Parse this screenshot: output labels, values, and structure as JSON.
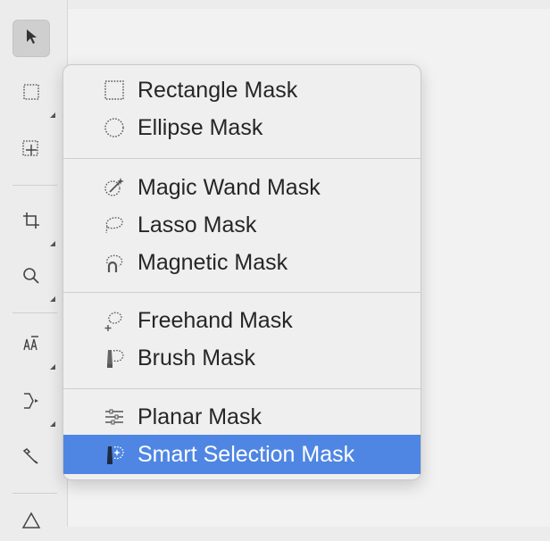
{
  "toolbar": {
    "tools": [
      {
        "icon": "arrow-pointer-icon",
        "selected": true
      },
      {
        "icon": "rectangle-mask-icon"
      },
      {
        "icon": "crosshair-select-icon"
      },
      {
        "icon": "crop-icon"
      },
      {
        "icon": "magnifier-icon"
      },
      {
        "icon": "text-format-icon"
      },
      {
        "icon": "bezier-path-icon"
      },
      {
        "icon": "brush-tool-icon"
      },
      {
        "icon": "warning-triangle-icon"
      }
    ]
  },
  "menu": {
    "groups": [
      [
        {
          "label": "Rectangle Mask",
          "icon": "rectangle-dotted-icon"
        },
        {
          "label": "Ellipse Mask",
          "icon": "ellipse-dotted-icon"
        }
      ],
      [
        {
          "label": "Magic Wand Mask",
          "icon": "magic-wand-icon"
        },
        {
          "label": "Lasso Mask",
          "icon": "lasso-icon"
        },
        {
          "label": "Magnetic Mask",
          "icon": "magnetic-lasso-icon"
        }
      ],
      [
        {
          "label": "Freehand Mask",
          "icon": "freehand-icon"
        },
        {
          "label": "Brush Mask",
          "icon": "brush-mask-icon"
        }
      ],
      [
        {
          "label": "Planar Mask",
          "icon": "planar-sliders-icon"
        },
        {
          "label": "Smart Selection Mask",
          "icon": "smart-selection-icon",
          "highlighted": true
        }
      ]
    ],
    "highlight_color": "#4f86e3"
  }
}
